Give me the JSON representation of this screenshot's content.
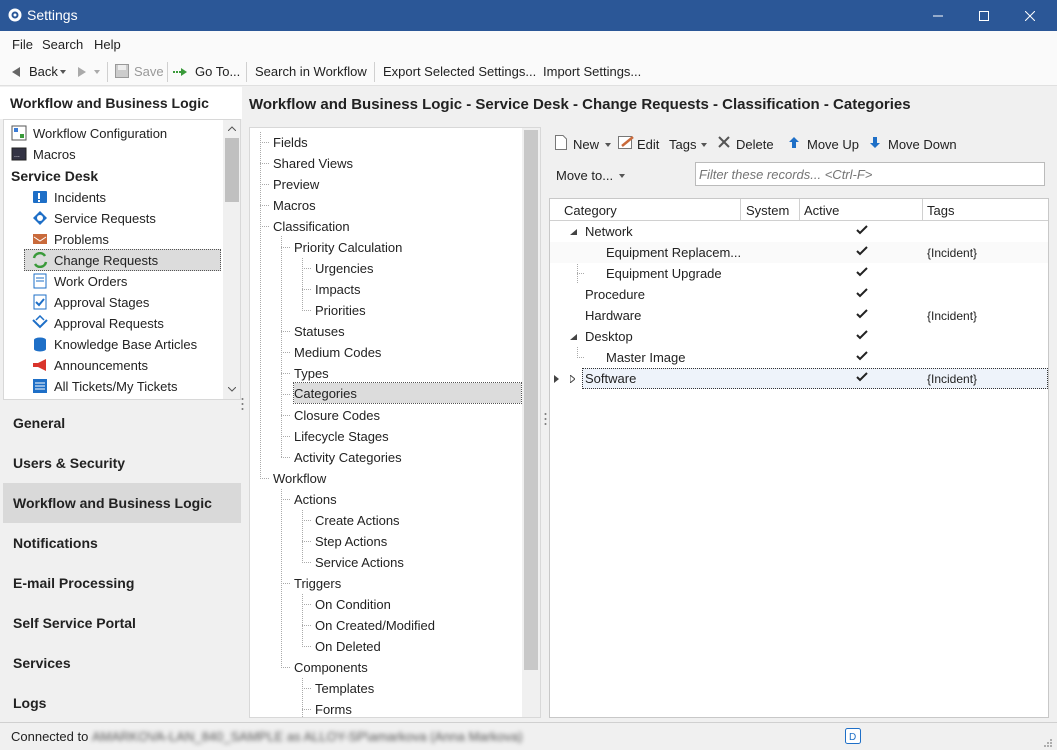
{
  "window": {
    "title": "Settings"
  },
  "menu": {
    "file": "File",
    "search": "Search",
    "help": "Help"
  },
  "toolbar": {
    "back": "Back",
    "save": "Save",
    "goto": "Go To...",
    "search_in_workflow": "Search in Workflow",
    "export": "Export Selected Settings...",
    "import": "Import Settings..."
  },
  "nav": {
    "header": "Workflow and Business Logic",
    "items": [
      {
        "label": "Workflow Configuration",
        "icon": "workflow-icon"
      },
      {
        "label": "Macros",
        "icon": "macro-icon"
      },
      {
        "label": "Service Desk",
        "icon": ""
      },
      {
        "label": "Incidents",
        "icon": "incident-icon"
      },
      {
        "label": "Service Requests",
        "icon": "service-request-icon"
      },
      {
        "label": "Problems",
        "icon": "problem-icon"
      },
      {
        "label": "Change Requests",
        "icon": "change-request-icon"
      },
      {
        "label": "Work Orders",
        "icon": "work-order-icon"
      },
      {
        "label": "Approval Stages",
        "icon": "approval-stage-icon"
      },
      {
        "label": "Approval Requests",
        "icon": "approval-request-icon"
      },
      {
        "label": "Knowledge Base Articles",
        "icon": "kb-icon"
      },
      {
        "label": "Announcements",
        "icon": "megaphone-icon"
      },
      {
        "label": "All Tickets/My Tickets",
        "icon": "tickets-icon"
      }
    ],
    "sections": [
      "General",
      "Users & Security",
      "Workflow and Business Logic",
      "Notifications",
      "E-mail Processing",
      "Self Service Portal",
      "Services",
      "Logs"
    ]
  },
  "content": {
    "header": "Workflow and Business Logic - Service Desk - Change Requests - Classification - Categories"
  },
  "tree": [
    "Fields",
    "Shared Views",
    "Preview",
    "Macros",
    "Classification",
    "Priority Calculation",
    "Urgencies",
    "Impacts",
    "Priorities",
    "Statuses",
    "Medium Codes",
    "Types",
    "Categories",
    "Closure Codes",
    "Lifecycle Stages",
    "Activity Categories",
    "Workflow",
    "Actions",
    "Create Actions",
    "Step Actions",
    "Service Actions",
    "Triggers",
    "On Condition",
    "On Created/Modified",
    "On Deleted",
    "Components",
    "Templates",
    "Forms"
  ],
  "grid_toolbar": {
    "new": "New",
    "edit": "Edit",
    "tags": "Tags",
    "delete": "Delete",
    "move_up": "Move Up",
    "move_down": "Move Down",
    "move_to": "Move to...",
    "filter_placeholder": "Filter these records... <Ctrl-F>"
  },
  "grid": {
    "columns": [
      "Category",
      "System",
      "Active",
      "Tags"
    ],
    "rows": [
      {
        "category": "Network",
        "active": true,
        "tags": ""
      },
      {
        "category": "Equipment Replacem...",
        "active": true,
        "tags": "{Incident}"
      },
      {
        "category": "Equipment Upgrade",
        "active": true,
        "tags": ""
      },
      {
        "category": "Procedure",
        "active": true,
        "tags": ""
      },
      {
        "category": "Hardware",
        "active": true,
        "tags": "{Incident}"
      },
      {
        "category": "Desktop",
        "active": true,
        "tags": ""
      },
      {
        "category": "Master Image",
        "active": true,
        "tags": ""
      },
      {
        "category": "Software",
        "active": true,
        "tags": "{Incident}"
      }
    ]
  },
  "status": {
    "label": "Connected to",
    "connection": "AMARKOVA-LAN_840_SAMPLE as ALLOY-SP\\amarkova (Anna Markova)"
  },
  "colors": {
    "titlebar": "#2b5797",
    "accent": "#1e6fc7"
  }
}
